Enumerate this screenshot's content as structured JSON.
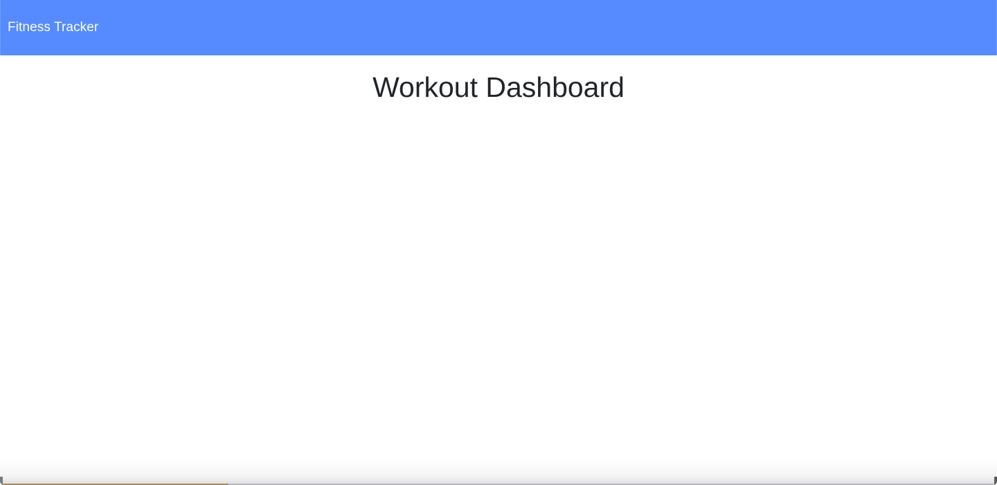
{
  "navbar": {
    "brand": "Fitness Tracker",
    "background_color": "#558bff",
    "text_color": "#ffffff"
  },
  "main": {
    "title": "Workout Dashboard",
    "title_color": "#212529"
  }
}
